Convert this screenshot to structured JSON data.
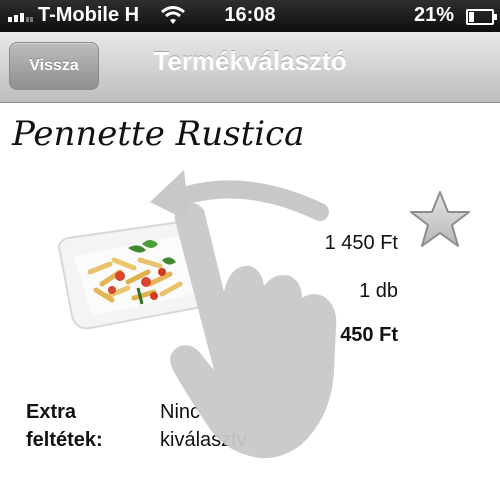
{
  "status_bar": {
    "carrier": "T-Mobile H",
    "time": "16:08",
    "battery": "21%",
    "battery_level": 0.21
  },
  "nav": {
    "back_label": "Vissza",
    "title": "Termékválasztó"
  },
  "product": {
    "name": "Pennette Rustica",
    "unit_price": "1 450 Ft",
    "quantity": "1 db",
    "total_visible": "450 Ft",
    "extra_label_line1": "Extra",
    "extra_label_line2": "feltétek:",
    "extra_value_line1": "Ninc",
    "extra_value_line2": "kiválasztv"
  },
  "icons": {
    "star": "star-icon",
    "gesture": "swipe-hand-icon",
    "wifi": "wifi-icon",
    "signal": "signal-icon",
    "battery": "battery-icon"
  }
}
